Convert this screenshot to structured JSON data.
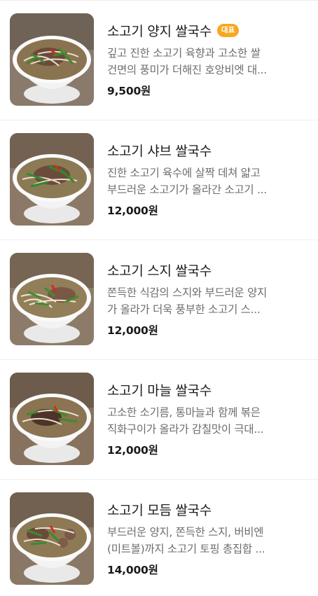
{
  "menu": {
    "items": [
      {
        "title": "소고기 양지 쌀국수",
        "badge": "대표",
        "desc_line1": "깊고 진한 소고기 육향과 고소한 쌀",
        "desc_line2": "건면의 풍미가 더해진 호앙비엣 대...",
        "price": "9,500원",
        "image": "pho-bowl-brisket"
      },
      {
        "title": "소고기 샤브 쌀국수",
        "desc_line1": "진한 소고기 육수에 살짝 데쳐 얇고",
        "desc_line2": "부드러운 소고기가 올라간 소고기 ...",
        "price": "12,000원",
        "image": "pho-bowl-shabu"
      },
      {
        "title": "소고기 스지 쌀국수",
        "desc_line1": "쫀득한 식감의 스지와 부드러운 양지",
        "desc_line2": "가 올라가 더욱 풍부한 소고기 스...",
        "price": "12,000원",
        "image": "pho-bowl-tendon"
      },
      {
        "title": "소고기 마늘 쌀국수",
        "desc_line1": "고소한 소기름, 통마늘과 함께 볶은",
        "desc_line2": "직화구이가 올라가 감칠맛이 극대...",
        "price": "12,000원",
        "image": "pho-bowl-garlic"
      },
      {
        "title": "소고기 모듬 쌀국수",
        "desc_line1": "부드러운 양지, 쫀득한 스지, 버비엔",
        "desc_line2": "(미트볼)까지 소고기 토핑 총집합 ...",
        "price": "14,000원",
        "image": "pho-bowl-combo"
      }
    ]
  }
}
